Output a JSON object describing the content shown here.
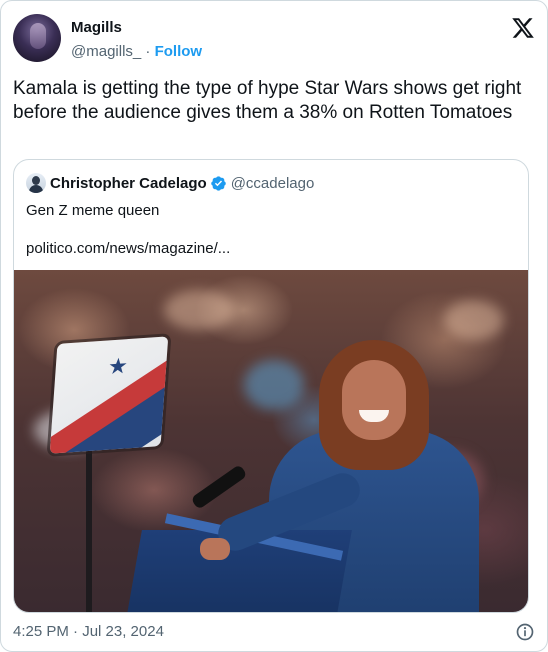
{
  "author": {
    "name": "Magills",
    "handle": "@magills_",
    "separator": "·",
    "follow_label": "Follow"
  },
  "tweet": {
    "text": "Kamala is getting the type of hype Star Wars shows get right before the audience gives them a 38% on Rotten Tomatoes"
  },
  "quoted": {
    "name": "Christopher Cadelago",
    "handle": "@ccadelago",
    "text": "Gen Z meme queen",
    "link": "politico.com/news/magazine/..."
  },
  "footer": {
    "timestamp": "4:25 PM · Jul 23, 2024"
  },
  "icons": {
    "brand": "x-logo-icon",
    "verified": "verified-badge-icon",
    "info": "info-icon"
  },
  "colors": {
    "link_blue": "#1d9bf0",
    "text": "#0f1419",
    "secondary": "#536471",
    "border": "#cfd9de"
  }
}
